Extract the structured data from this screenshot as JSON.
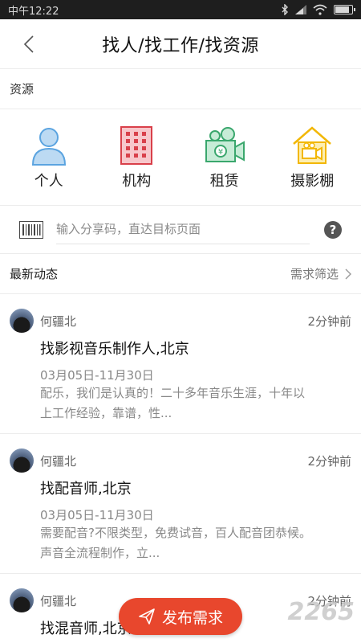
{
  "status": {
    "time": "中午12:22",
    "battery_level": 0.9,
    "icons": [
      "bluetooth-icon",
      "signal-icon",
      "wifi-icon",
      "battery-icon"
    ]
  },
  "header": {
    "title": "找人/找工作/找资源"
  },
  "section": {
    "label": "资源"
  },
  "categories": [
    {
      "label": "个人",
      "icon": "person-icon"
    },
    {
      "label": "机构",
      "icon": "building-icon"
    },
    {
      "label": "租赁",
      "icon": "rental-camera-icon"
    },
    {
      "label": "摄影棚",
      "icon": "studio-house-icon"
    }
  ],
  "share": {
    "placeholder": "输入分享码，直达目标页面"
  },
  "feed": {
    "title": "最新动态",
    "filter": "需求筛选"
  },
  "posts": [
    {
      "author": "何疆北",
      "time": "2分钟前",
      "title": "找影视音乐制作人,北京",
      "date": "03月05日-11月30日",
      "desc1": "配乐，我们是认真的！二十多年音乐生涯，十年以",
      "desc2": "上工作经验，靠谱，性..."
    },
    {
      "author": "何疆北",
      "time": "2分钟前",
      "title": "找配音师,北京",
      "date": "03月05日-11月30日",
      "desc1": "需要配音?不限类型，免费试音，百人配音团恭候。",
      "desc2": "声音全流程制作，立..."
    },
    {
      "author": "何疆北",
      "time": "2分钟前",
      "title": "找混音师,北京"
    }
  ],
  "fab": {
    "label": "发布需求"
  },
  "watermark": {
    "text": "2265"
  },
  "colors": {
    "accent": "#e8472d",
    "person": "#5ba4e0",
    "building": "#d9404a",
    "rental": "#3aa76d",
    "studio": "#f2b705"
  }
}
